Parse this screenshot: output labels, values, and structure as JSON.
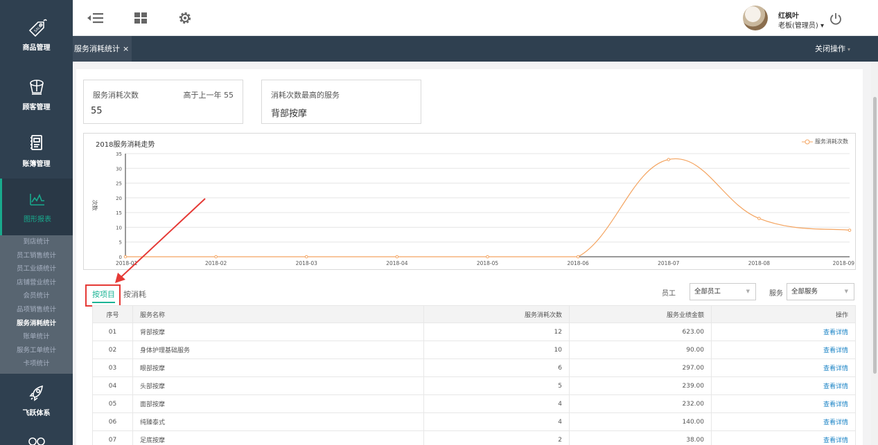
{
  "sidebar": {
    "items": [
      {
        "label": "商品管理",
        "icon": "sale-tag-icon"
      },
      {
        "label": "顾客管理",
        "icon": "crown-icon"
      },
      {
        "label": "账簿管理",
        "icon": "ledger-icon"
      },
      {
        "label": "图形报表",
        "icon": "chart-line-icon",
        "active": true
      },
      {
        "label": "飞跃体系",
        "icon": "rocket-icon"
      }
    ],
    "submenu": [
      "到店统计",
      "员工销售统计",
      "员工业绩统计",
      "店铺营业统计",
      "会员统计",
      "品项销售统计",
      "服务消耗统计",
      "账单统计",
      "服务工单统计",
      "卡项统计"
    ],
    "submenu_current": "服务消耗统计"
  },
  "user": {
    "name": "红枫叶",
    "role": "老板(管理员)"
  },
  "tabbar": {
    "tab_label": "服务消耗统计",
    "tab_close": "×",
    "close_ops": "关闭操作"
  },
  "cards": {
    "consume": {
      "title": "服务消耗次数",
      "value": "55",
      "compare": "高于上一年 55"
    },
    "top_service": {
      "title": "消耗次数最高的服务",
      "value": "背部按摩"
    }
  },
  "chart_data": {
    "type": "line",
    "title": "2018服务消耗走势",
    "ylabel": "次数",
    "xlabel": "",
    "categories": [
      "2018-01",
      "2018-02",
      "2018-03",
      "2018-04",
      "2018-05",
      "2018-06",
      "2018-07",
      "2018-08",
      "2018-09"
    ],
    "series": [
      {
        "name": "服务消耗次数",
        "values": [
          0,
          0,
          0,
          0,
          0,
          0,
          33,
          13,
          9
        ]
      }
    ],
    "ylim": [
      0,
      35
    ],
    "yticks": [
      0,
      5,
      10,
      15,
      20,
      25,
      30,
      35
    ],
    "grid": true,
    "legend": "top-right",
    "color": "#f4a460"
  },
  "lower": {
    "toggle_project": "按项目",
    "toggle_consume": "按消耗",
    "filter_employee_label": "员工",
    "filter_employee_value": "全部员工",
    "filter_service_label": "服务",
    "filter_service_value": "全部服务"
  },
  "table": {
    "headers": [
      "序号",
      "服务名称",
      "服务消耗次数",
      "服务业绩金额",
      "操作"
    ],
    "rows": [
      {
        "idx": "01",
        "name": "背部按摩",
        "count": "12",
        "amount": "623.00",
        "op": "查看详情"
      },
      {
        "idx": "02",
        "name": "身体护理基础服务",
        "count": "10",
        "amount": "90.00",
        "op": "查看详情"
      },
      {
        "idx": "03",
        "name": "眼部按摩",
        "count": "6",
        "amount": "297.00",
        "op": "查看详情"
      },
      {
        "idx": "04",
        "name": "头部按摩",
        "count": "5",
        "amount": "239.00",
        "op": "查看详情"
      },
      {
        "idx": "05",
        "name": "面部按摩",
        "count": "4",
        "amount": "232.00",
        "op": "查看详情"
      },
      {
        "idx": "06",
        "name": "纯臻泰式",
        "count": "4",
        "amount": "140.00",
        "op": "查看详情"
      },
      {
        "idx": "07",
        "name": "足底按摩",
        "count": "2",
        "amount": "38.00",
        "op": "查看详情"
      }
    ]
  },
  "colors": {
    "sidebar_bg": "#2f4050",
    "accent": "#1ab394",
    "amount_red": "#e53935",
    "link_blue": "#1c84c6",
    "annotation_red": "#e53935"
  }
}
